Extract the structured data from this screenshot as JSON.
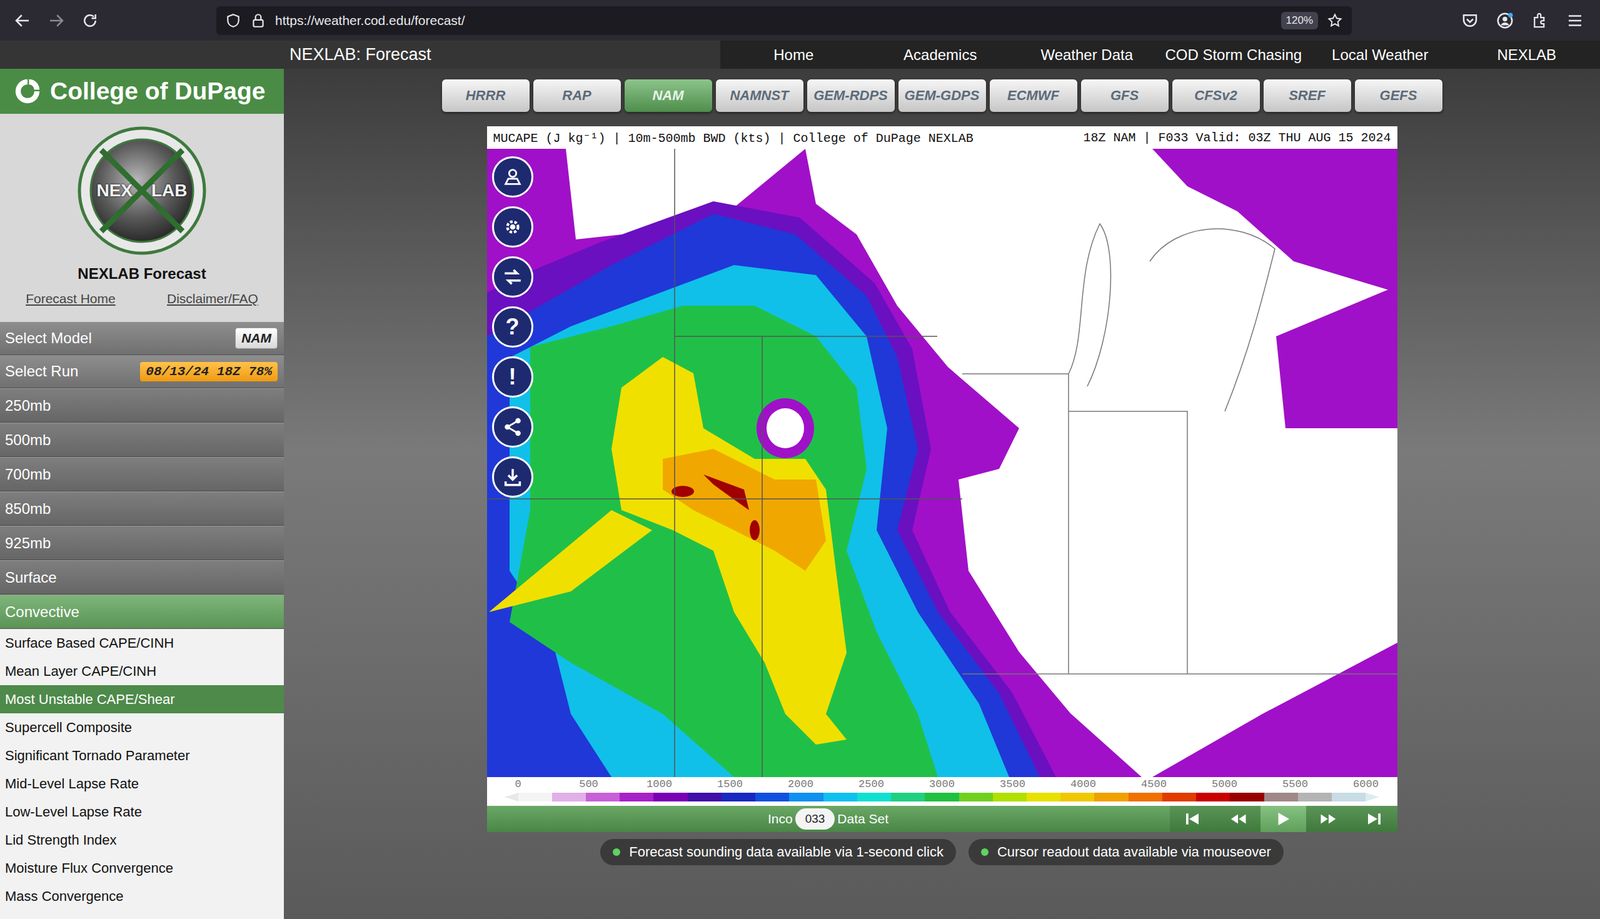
{
  "browser": {
    "url": "https://weather.cod.edu/forecast/",
    "zoom": "120%"
  },
  "site": {
    "title": "NEXLAB: Forecast",
    "nav": [
      "Home",
      "Academics",
      "Weather Data",
      "COD Storm Chasing",
      "Local Weather",
      "NEXLAB"
    ]
  },
  "sidebar": {
    "brand": "College of DuPage",
    "logo": {
      "left": "NEX",
      "right": "LAB"
    },
    "heading": "NEXLAB Forecast",
    "links": [
      "Forecast Home",
      "Disclaimer/FAQ"
    ],
    "selectors": [
      {
        "label": "Select Model",
        "value": "NAM",
        "kind": "model"
      },
      {
        "label": "Select Run",
        "value": "08/13/24 18Z 78%",
        "kind": "run"
      }
    ],
    "menu": [
      {
        "label": "250mb",
        "selected": false
      },
      {
        "label": "500mb",
        "selected": false
      },
      {
        "label": "700mb",
        "selected": false
      },
      {
        "label": "850mb",
        "selected": false
      },
      {
        "label": "925mb",
        "selected": false
      },
      {
        "label": "Surface",
        "selected": false
      },
      {
        "label": "Convective",
        "selected": true
      }
    ],
    "submenu": [
      {
        "label": "Surface Based CAPE/CINH",
        "selected": false
      },
      {
        "label": "Mean Layer CAPE/CINH",
        "selected": false
      },
      {
        "label": "Most Unstable CAPE/Shear",
        "selected": true
      },
      {
        "label": "Supercell Composite",
        "selected": false
      },
      {
        "label": "Significant Tornado Parameter",
        "selected": false
      },
      {
        "label": "Mid-Level Lapse Rate",
        "selected": false
      },
      {
        "label": "Low-Level Lapse Rate",
        "selected": false
      },
      {
        "label": "Lid Strength Index",
        "selected": false
      },
      {
        "label": "Moisture Flux Convergence",
        "selected": false
      },
      {
        "label": "Mass Convergence",
        "selected": false
      }
    ]
  },
  "models": [
    {
      "label": "HRRR",
      "selected": false
    },
    {
      "label": "RAP",
      "selected": false
    },
    {
      "label": "NAM",
      "selected": true
    },
    {
      "label": "NAMNST",
      "selected": false
    },
    {
      "label": "GEM-RDPS",
      "selected": false
    },
    {
      "label": "GEM-GDPS",
      "selected": false
    },
    {
      "label": "ECMWF",
      "selected": false
    },
    {
      "label": "GFS",
      "selected": false
    },
    {
      "label": "CFSv2",
      "selected": false
    },
    {
      "label": "SREF",
      "selected": false
    },
    {
      "label": "GEFS",
      "selected": false
    }
  ],
  "map": {
    "title": "MUCAPE (J kg⁻¹) | 10m-500mb BWD (kts) | College of DuPage NEXLAB",
    "run": "18Z NAM | F033 Valid: 03Z THU AUG 15 2024",
    "tools": [
      {
        "kind": "user"
      },
      {
        "kind": "gear"
      },
      {
        "kind": "swap"
      },
      {
        "kind": "text",
        "glyph": "?"
      },
      {
        "kind": "text",
        "glyph": "!"
      },
      {
        "kind": "share"
      },
      {
        "kind": "download"
      }
    ],
    "colorbar": {
      "ticks": [
        "0",
        "500",
        "1000",
        "1500",
        "2000",
        "2500",
        "3000",
        "3500",
        "4000",
        "4500",
        "5000",
        "5500",
        "6000"
      ],
      "colors": [
        "#f4f4f4",
        "#e0b0e8",
        "#c860d8",
        "#a820c8",
        "#7a00b4",
        "#4010a8",
        "#1828c0",
        "#1050e0",
        "#1090f0",
        "#10c0f0",
        "#10e0d0",
        "#20d080",
        "#20c040",
        "#70d020",
        "#b0e000",
        "#e8e000",
        "#f0c800",
        "#f0a000",
        "#f07000",
        "#e03c00",
        "#c80000",
        "#960000",
        "#a08888",
        "#b4b4b4",
        "#c8dce4"
      ]
    }
  },
  "timeline": {
    "left": "Inco",
    "thumb": "033",
    "right": "Data Set"
  },
  "player": [
    {
      "kind": "first",
      "selected": false
    },
    {
      "kind": "back",
      "selected": false
    },
    {
      "kind": "play",
      "selected": true
    },
    {
      "kind": "forward",
      "selected": false
    },
    {
      "kind": "last",
      "selected": false
    }
  ],
  "notes": [
    "Forecast sounding data available via 1-second click",
    "Cursor readout data available via mouseover"
  ]
}
